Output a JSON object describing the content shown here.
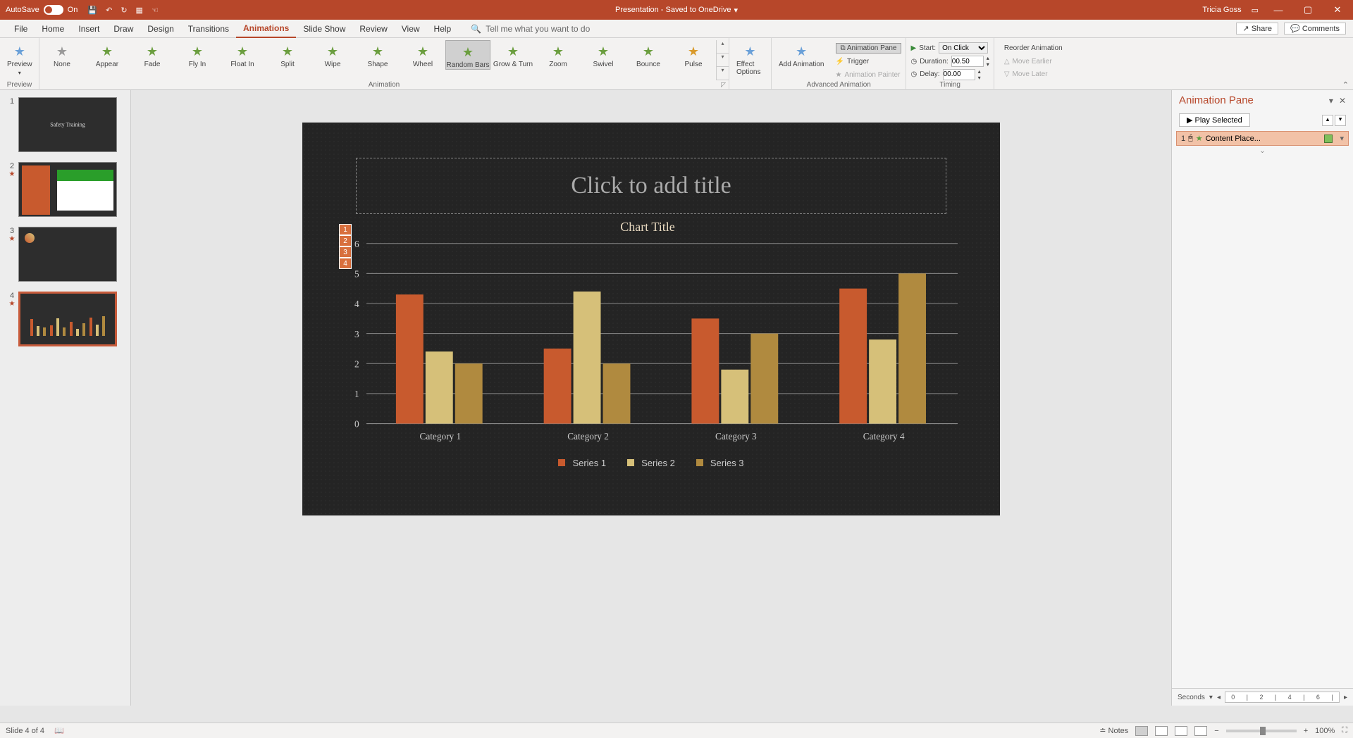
{
  "titlebar": {
    "autosave": "AutoSave",
    "autosave_state": "On",
    "doc_title": "Presentation - Saved to OneDrive",
    "user": "Tricia Goss"
  },
  "menu": {
    "tabs": [
      "File",
      "Home",
      "Insert",
      "Draw",
      "Design",
      "Transitions",
      "Animations",
      "Slide Show",
      "Review",
      "View",
      "Help"
    ],
    "active": "Animations",
    "tell_me": "Tell me what you want to do",
    "share": "Share",
    "comments": "Comments"
  },
  "ribbon": {
    "preview": "Preview",
    "preview_group": "Preview",
    "animations": [
      "None",
      "Appear",
      "Fade",
      "Fly In",
      "Float In",
      "Split",
      "Wipe",
      "Shape",
      "Wheel",
      "Random Bars",
      "Grow & Turn",
      "Zoom",
      "Swivel",
      "Bounce",
      "Pulse"
    ],
    "selected_anim": "Random Bars",
    "effect_options": "Effect Options",
    "animation_group": "Animation",
    "add_anim": "Add Animation",
    "anim_pane_btn": "Animation Pane",
    "trigger": "Trigger",
    "anim_painter": "Animation Painter",
    "adv_group": "Advanced Animation",
    "start_lbl": "Start:",
    "start_val": "On Click",
    "duration_lbl": "Duration:",
    "duration_val": "00.50",
    "delay_lbl": "Delay:",
    "delay_val": "00.00",
    "reorder": "Reorder Animation",
    "move_earlier": "Move Earlier",
    "move_later": "Move Later",
    "timing_group": "Timing"
  },
  "thumbs": [
    {
      "n": "1",
      "title": "Safety Training"
    },
    {
      "n": "2",
      "title": ""
    },
    {
      "n": "3",
      "title": ""
    },
    {
      "n": "4",
      "title": ""
    }
  ],
  "slide": {
    "title_placeholder": "Click to add title",
    "seq_tags": [
      "1",
      "2",
      "3",
      "4"
    ]
  },
  "chart_data": {
    "type": "bar",
    "title": "Chart Title",
    "categories": [
      "Category 1",
      "Category 2",
      "Category 3",
      "Category 4"
    ],
    "series": [
      {
        "name": "Series 1",
        "color": "#c85a2e",
        "values": [
          4.3,
          2.5,
          3.5,
          4.5
        ]
      },
      {
        "name": "Series 2",
        "color": "#d6c079",
        "values": [
          2.4,
          4.4,
          1.8,
          2.8
        ]
      },
      {
        "name": "Series 3",
        "color": "#b08a3f",
        "values": [
          2.0,
          2.0,
          3.0,
          5.0
        ]
      }
    ],
    "ylim": [
      0,
      6
    ],
    "yticks": [
      0,
      1,
      2,
      3,
      4,
      5,
      6
    ]
  },
  "anim_pane": {
    "title": "Animation Pane",
    "play": "Play Selected",
    "item_num": "1",
    "item_label": "Content Place...",
    "seconds": "Seconds",
    "scale": [
      "0",
      "2",
      "4",
      "6"
    ]
  },
  "status": {
    "slide_info": "Slide 4 of 4",
    "notes": "Notes",
    "zoom": "100%"
  }
}
